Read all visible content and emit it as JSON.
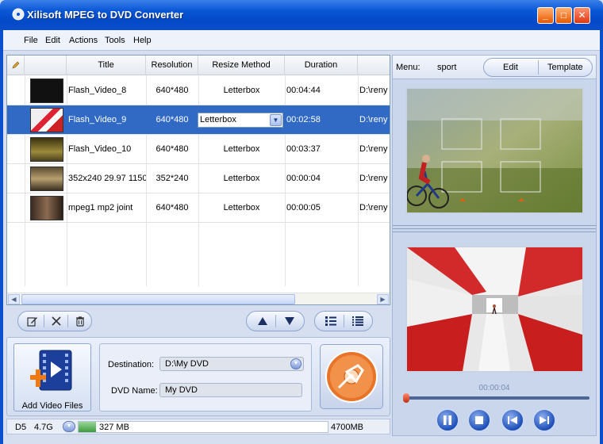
{
  "window": {
    "title": "Xilisoft MPEG to DVD Converter",
    "min": "_",
    "max": "□",
    "close": "✕"
  },
  "menu": [
    "File",
    "Edit",
    "Actions",
    "Tools",
    "Help"
  ],
  "table": {
    "headers": {
      "title": "Title",
      "resolution": "Resolution",
      "resize": "Resize Method",
      "duration": "Duration"
    },
    "rows": [
      {
        "title": "Flash_Video_8",
        "resolution": "640*480",
        "resize": "Letterbox",
        "duration": "00:04:44",
        "path": "D:\\reny",
        "selected": false
      },
      {
        "title": "Flash_Video_9",
        "resolution": "640*480",
        "resize": "Letterbox",
        "duration": "00:02:58",
        "path": "D:\\reny",
        "selected": true
      },
      {
        "title": "Flash_Video_10",
        "resolution": "640*480",
        "resize": "Letterbox",
        "duration": "00:03:37",
        "path": "D:\\reny",
        "selected": false
      },
      {
        "title": "352x240 29.97 1150",
        "resolution": "352*240",
        "resize": "Letterbox",
        "duration": "00:00:04",
        "path": "D:\\reny",
        "selected": false
      },
      {
        "title": "mpeg1 mp2 joint",
        "resolution": "640*480",
        "resize": "Letterbox",
        "duration": "00:00:05",
        "path": "D:\\reny",
        "selected": false
      }
    ]
  },
  "bottom": {
    "add_label": "Add Video Files",
    "destination_label": "Destination:",
    "destination_value": "D:\\My DVD",
    "dvd_name_label": "DVD Name:",
    "dvd_name_value": "My DVD"
  },
  "status": {
    "disc": "D5",
    "capacity": "4.7G",
    "used": "327 MB",
    "total": "4700MB",
    "used_fraction": 0.07
  },
  "preview": {
    "menu_label": "Menu:",
    "menu_value": "sport",
    "edit_tab": "Edit",
    "template_tab": "Template",
    "time": "00:00:04"
  },
  "colors": {
    "selection": "#316ac5",
    "titlebar": "#0a57d6",
    "accent_orange": "#e85800"
  }
}
